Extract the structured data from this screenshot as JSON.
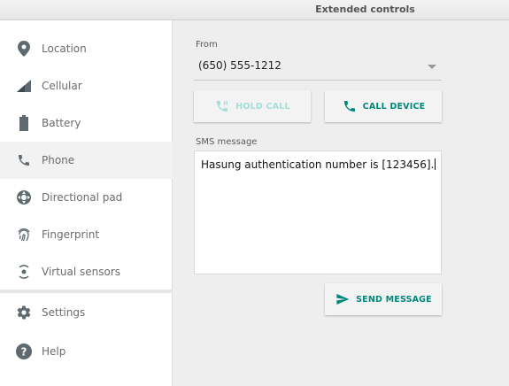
{
  "window": {
    "title": "Extended controls"
  },
  "sidebar": {
    "items": [
      {
        "label": "Location",
        "icon": "location-pin-icon"
      },
      {
        "label": "Cellular",
        "icon": "signal-icon"
      },
      {
        "label": "Battery",
        "icon": "battery-icon"
      },
      {
        "label": "Phone",
        "icon": "phone-icon",
        "active": true
      },
      {
        "label": "Directional pad",
        "icon": "dpad-icon"
      },
      {
        "label": "Fingerprint",
        "icon": "fingerprint-icon"
      },
      {
        "label": "Virtual sensors",
        "icon": "sensors-icon"
      }
    ],
    "bottom_items": [
      {
        "label": "Settings",
        "icon": "gear-icon"
      },
      {
        "label": "Help",
        "icon": "help-icon"
      }
    ]
  },
  "phone": {
    "from_label": "From",
    "from_value": "(650) 555-1212",
    "hold_call_label": "HOLD CALL",
    "call_device_label": "CALL DEVICE",
    "sms_label": "SMS message",
    "sms_text": "Hasung authentication number is [123456].",
    "send_message_label": "SEND MESSAGE"
  },
  "colors": {
    "accent": "#00897b",
    "accent_disabled": "#a6ddd6",
    "icon_gray": "#6b6b6b"
  }
}
